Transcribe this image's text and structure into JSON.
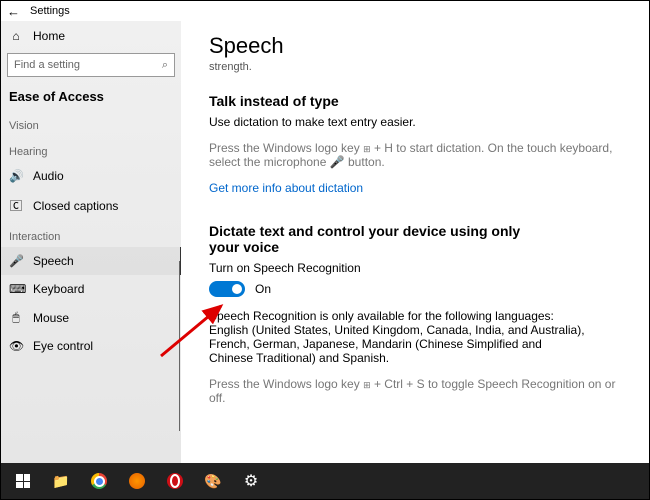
{
  "titlebar": {
    "app": "Settings"
  },
  "sidebar": {
    "home": "Home",
    "search_placeholder": "Find a setting",
    "category": "Ease of Access",
    "groups": [
      {
        "label": "Vision",
        "items": []
      },
      {
        "label": "Hearing",
        "items": [
          {
            "icon": "🔊",
            "label": "Audio"
          },
          {
            "icon": "🄲",
            "label": "Closed captions"
          }
        ]
      },
      {
        "label": "Interaction",
        "items": [
          {
            "icon": "🎤",
            "label": "Speech",
            "selected": true
          },
          {
            "icon": "⌨",
            "label": "Keyboard"
          },
          {
            "icon": "🖱",
            "label": "Mouse"
          },
          {
            "icon": "👁",
            "label": "Eye control"
          }
        ]
      }
    ]
  },
  "main": {
    "title": "Speech",
    "subline": "strength.",
    "section1_h": "Talk instead of type",
    "section1_p": "Use dictation to make text entry easier.",
    "section1_hint_a": "Press the Windows logo key ",
    "section1_hint_b": " + H to start dictation.  On the touch keyboard, select the microphone 🎤 button.",
    "link": "Get more info about dictation",
    "section2_h": "Dictate text and control your device using only your voice",
    "toggle_label": "Turn on Speech Recognition",
    "toggle_state": "On",
    "section2_p": "Speech Recognition is only available for the following languages: English (United States, United Kingdom, Canada, India, and Australia), French, German, Japanese, Mandarin (Chinese Simplified and Chinese Traditional) and Spanish.",
    "section2_hint_a": "Press the Windows logo key ",
    "section2_hint_b": " + Ctrl + S to toggle Speech Recognition on or off."
  },
  "taskbar": {
    "items": [
      "start",
      "explorer",
      "chrome",
      "firefox",
      "opera",
      "paint",
      "settings"
    ]
  },
  "colors": {
    "accent": "#0078d4",
    "link": "#0066cc"
  }
}
